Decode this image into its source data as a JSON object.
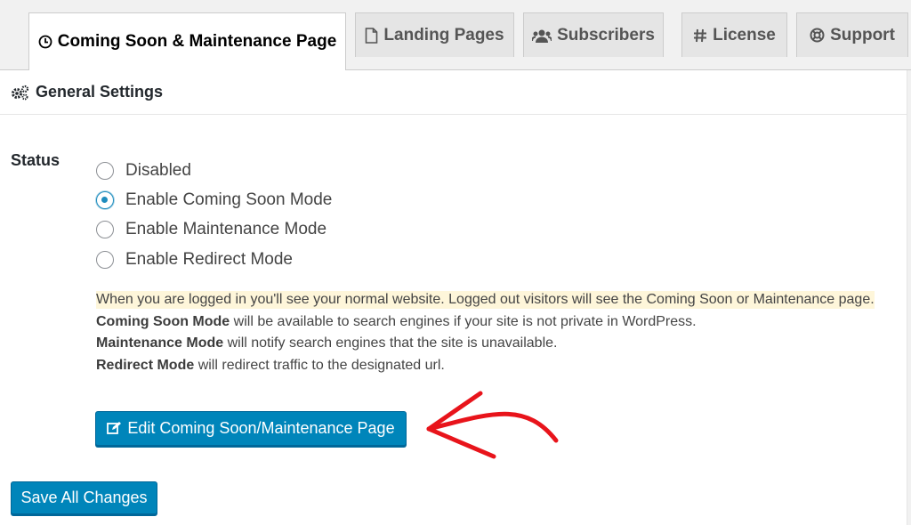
{
  "tabs": [
    {
      "label": "Coming Soon & Maintenance Page",
      "icon": "clock-icon",
      "active": true
    },
    {
      "label": "Landing Pages",
      "icon": "file-icon",
      "active": false
    },
    {
      "label": "Subscribers",
      "icon": "users-icon",
      "active": false
    },
    {
      "label": "License",
      "icon": "hash-icon",
      "active": false
    },
    {
      "label": "Support",
      "icon": "lifebuoy-icon",
      "active": false
    }
  ],
  "section": {
    "title": "General Settings",
    "icon": "gears-icon"
  },
  "status": {
    "label": "Status",
    "options": [
      "Disabled",
      "Enable Coming Soon Mode",
      "Enable Maintenance Mode",
      "Enable Redirect Mode"
    ],
    "selected": "Enable Coming Soon Mode"
  },
  "notes": {
    "highlight": "When you are logged in you'll see your normal website. Logged out visitors will see the Coming Soon or Maintenance page.",
    "coming_soon_bold": "Coming Soon Mode",
    "coming_soon_rest": " will be available to search engines if your site is not private in WordPress.",
    "maintenance_bold": "Maintenance Mode",
    "maintenance_rest": " will notify search engines that the site is unavailable.",
    "redirect_bold": "Redirect Mode",
    "redirect_rest": " will redirect traffic to the designated url."
  },
  "buttons": {
    "edit_page": "Edit Coming Soon/Maintenance Page",
    "save_all": "Save All Changes"
  },
  "colors": {
    "primary": "#0085ba",
    "highlight": "#fef6da",
    "annotation_arrow": "#e8141b"
  }
}
